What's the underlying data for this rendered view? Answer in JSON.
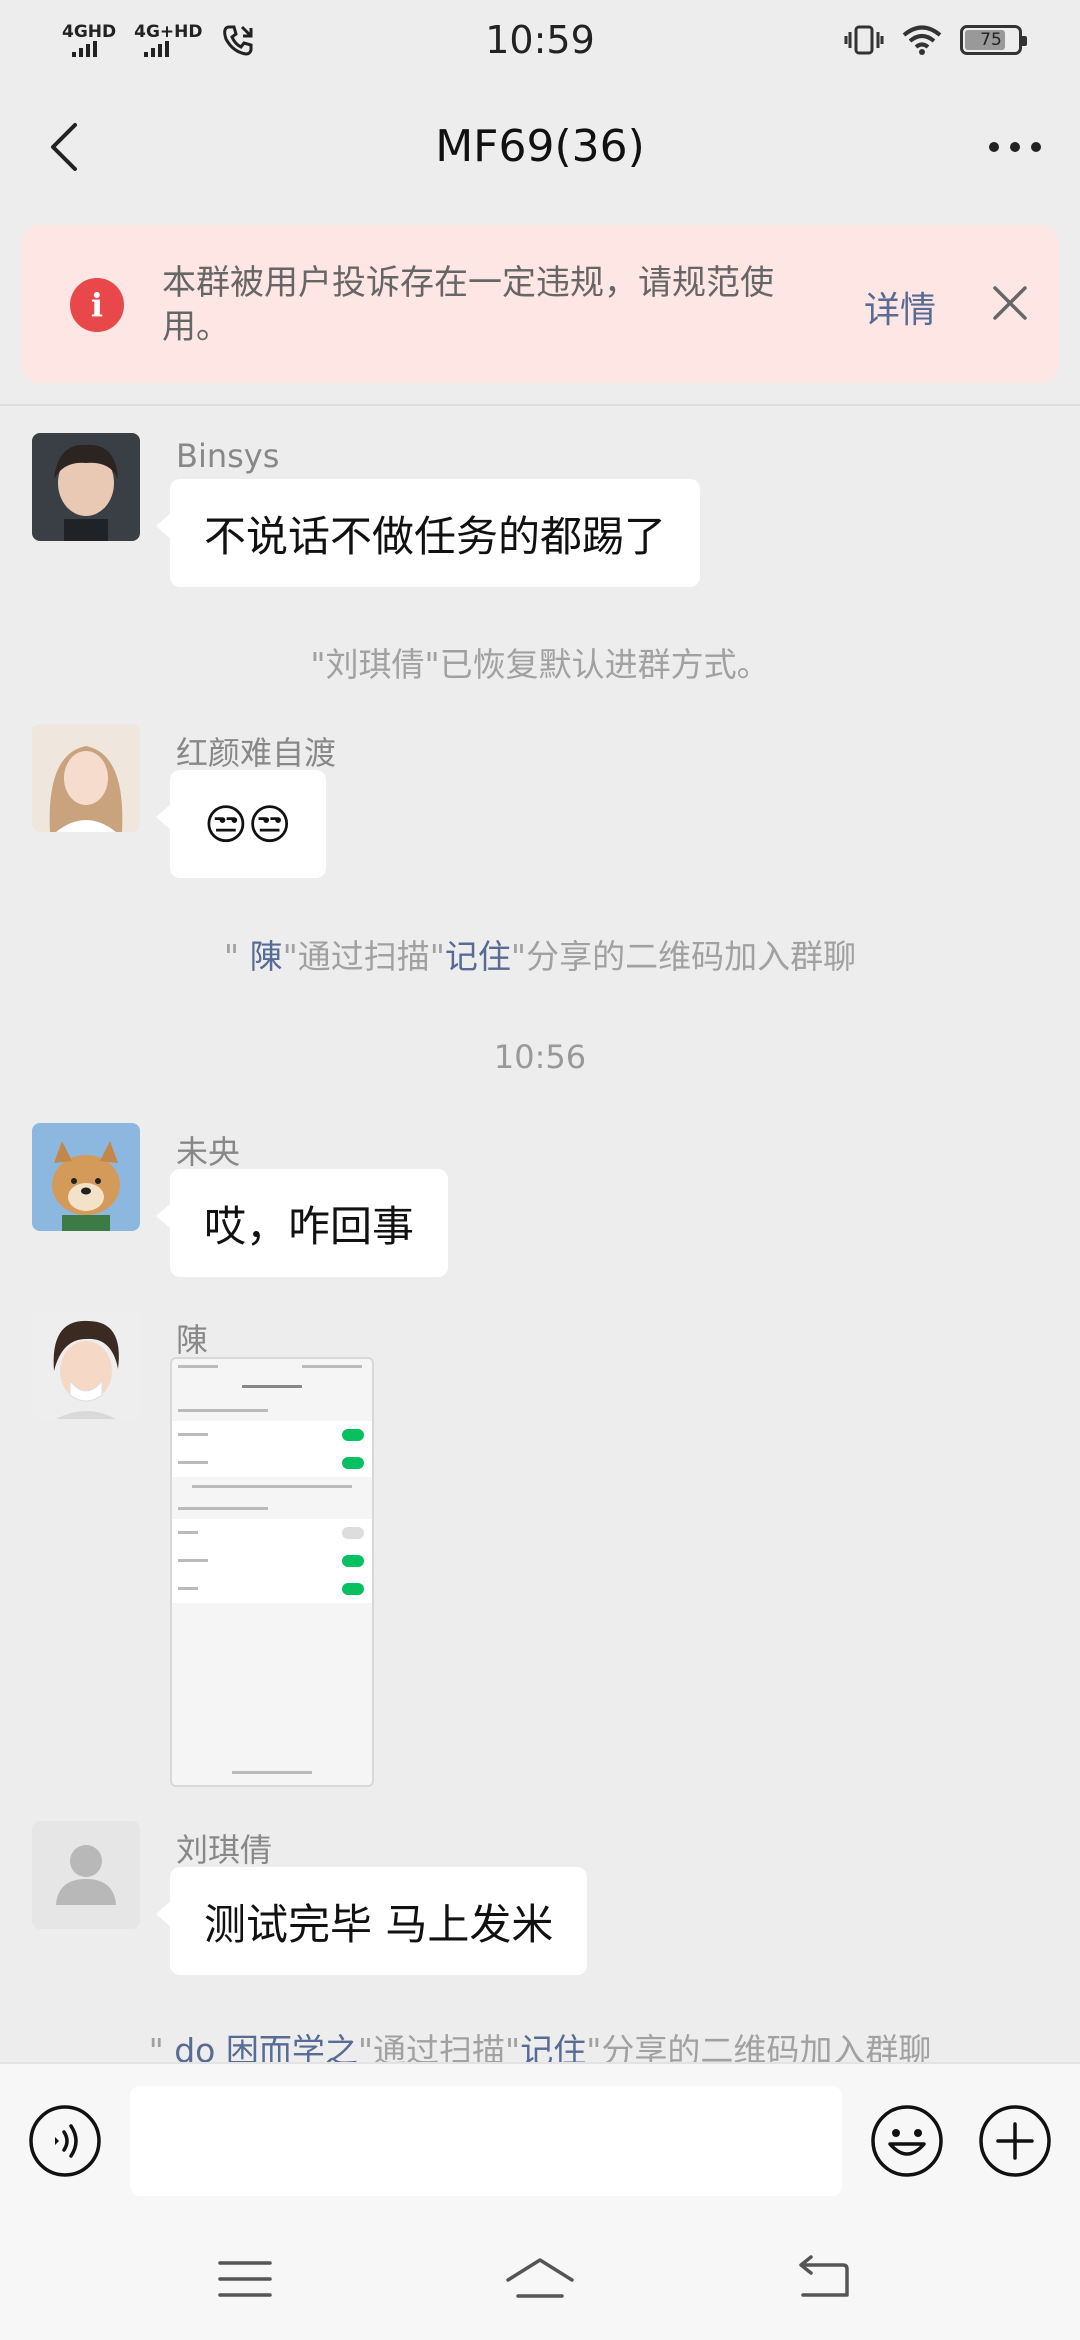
{
  "status_bar": {
    "network1": "4GHD",
    "network2": "4G+HD",
    "time": "10:59",
    "battery": "75"
  },
  "header": {
    "title": "MF69(36)"
  },
  "notice": {
    "text": "本群被用户投诉存在一定违规，请规范使用。",
    "detail_label": "详情",
    "accent_color": "#e8484a"
  },
  "messages": [
    {
      "sender": "Binsys",
      "text": "不说话不做任务的都踢了"
    },
    {
      "system": "\"刘琪倩\"已恢复默认进群方式。"
    },
    {
      "sender": "红颜难自渡",
      "text": "😒😒"
    },
    {
      "system_parts": [
        "\" ",
        "陳",
        "\"通过扫描\"",
        "记住",
        "\"分享的二维码加入群聊"
      ]
    },
    {
      "timestamp": "10:56"
    },
    {
      "sender": "未央",
      "text": "哎，咋回事"
    },
    {
      "sender": "陳",
      "image": "screenshot-thumbnail"
    },
    {
      "sender": "刘琪倩",
      "text": "测试完毕 马上发米"
    },
    {
      "system_parts": [
        "\" ",
        "do 困而学之",
        "\"通过扫描\"",
        "记住",
        "\"分享的二维码加入群聊"
      ]
    }
  ],
  "input": {
    "value": "",
    "placeholder": ""
  },
  "colors": {
    "link": "#576b95",
    "background": "#ededed",
    "bubble": "#ffffff"
  }
}
